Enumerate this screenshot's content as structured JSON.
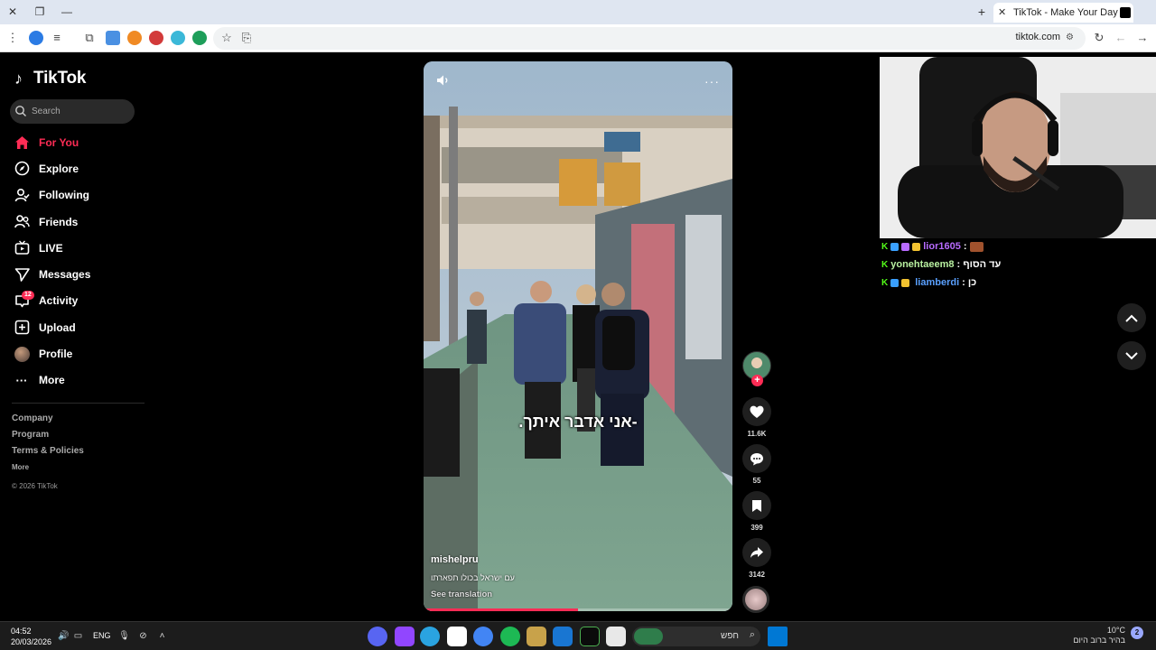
{
  "browser": {
    "tab_title": "TikTok - Make Your Day",
    "url": "tiktok.com"
  },
  "sidebar": {
    "logo_text": "TikTok",
    "search_placeholder": "Search",
    "nav": [
      {
        "label": "For You",
        "icon": "home-icon",
        "active": true
      },
      {
        "label": "Explore",
        "icon": "compass-icon"
      },
      {
        "label": "Following",
        "icon": "user-follow-icon"
      },
      {
        "label": "Friends",
        "icon": "friends-icon"
      },
      {
        "label": "LIVE",
        "icon": "live-tv-icon"
      },
      {
        "label": "Messages",
        "icon": "paper-plane-icon"
      },
      {
        "label": "Activity",
        "icon": "inbox-icon",
        "badge": "12"
      },
      {
        "label": "Upload",
        "icon": "plus-square-icon"
      },
      {
        "label": "Profile",
        "icon": "avatar-icon"
      },
      {
        "label": "More",
        "icon": "ellipsis-icon"
      }
    ],
    "footer": {
      "company": "Company",
      "program": "Program",
      "terms": "Terms & Policies",
      "more": "More",
      "copyright": "© 2026 TikTok"
    }
  },
  "video": {
    "caption": "-אני אדבר איתך.",
    "username": "mishelpru",
    "description": "עם ישראל בכולו תפארתו",
    "translate": "See translation",
    "progress": 0.5
  },
  "actions": {
    "likes": "11.6K",
    "comments": "55",
    "saves": "399",
    "shares": "3142"
  },
  "chat": [
    {
      "user": "lior1605",
      "sep": ":",
      "msg": "",
      "color": "#b86bff"
    },
    {
      "user": "yonehtaeem8",
      "sep": ":",
      "msg": "עד הסוף",
      "color": "#b8f0a0"
    },
    {
      "user": "liamberdi",
      "sep": ":",
      "msg": "כן",
      "color": "#5aa0ff"
    }
  ],
  "taskbar": {
    "time": "04:52",
    "date": "20/03/2026",
    "lang": "ENG",
    "search_label": "חפש",
    "temp": "10°C",
    "weather": "בהיר ברוב היום",
    "notif_count": "2"
  },
  "colors": {
    "accent": "#fe2c55",
    "kick_green": "#53fc18"
  }
}
